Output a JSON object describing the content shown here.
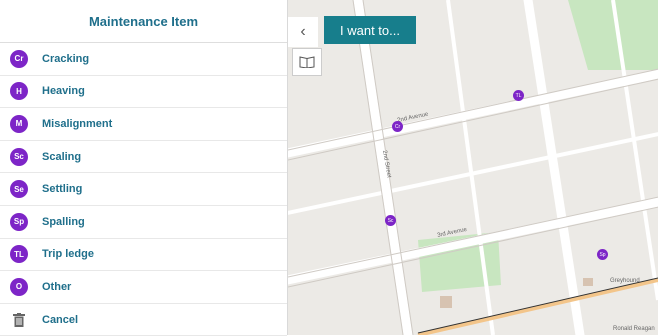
{
  "panel": {
    "title": "Maintenance Item",
    "items": [
      {
        "badge": "Cr",
        "label": "Cracking"
      },
      {
        "badge": "H",
        "label": "Heaving"
      },
      {
        "badge": "M",
        "label": "Misalignment"
      },
      {
        "badge": "Sc",
        "label": "Scaling"
      },
      {
        "badge": "Se",
        "label": "Settling"
      },
      {
        "badge": "Sp",
        "label": "Spalling"
      },
      {
        "badge": "TL",
        "label": "Trip ledge"
      },
      {
        "badge": "O",
        "label": "Other"
      }
    ],
    "cancel_label": "Cancel"
  },
  "toolbar": {
    "collapse_glyph": "‹",
    "want_label": "I want to..."
  },
  "map": {
    "streets": [
      "2nd Avenue",
      "2nd Street",
      "3rd Avenue"
    ],
    "poi_markers": [
      "Cr",
      "TL",
      "Sc",
      "Sp"
    ],
    "place_labels": [
      "Greyhound",
      "Ronald Reagan"
    ],
    "colors": {
      "road": "#ffffff",
      "park": "#c8e6c0",
      "marker": "#7d25c7"
    }
  }
}
